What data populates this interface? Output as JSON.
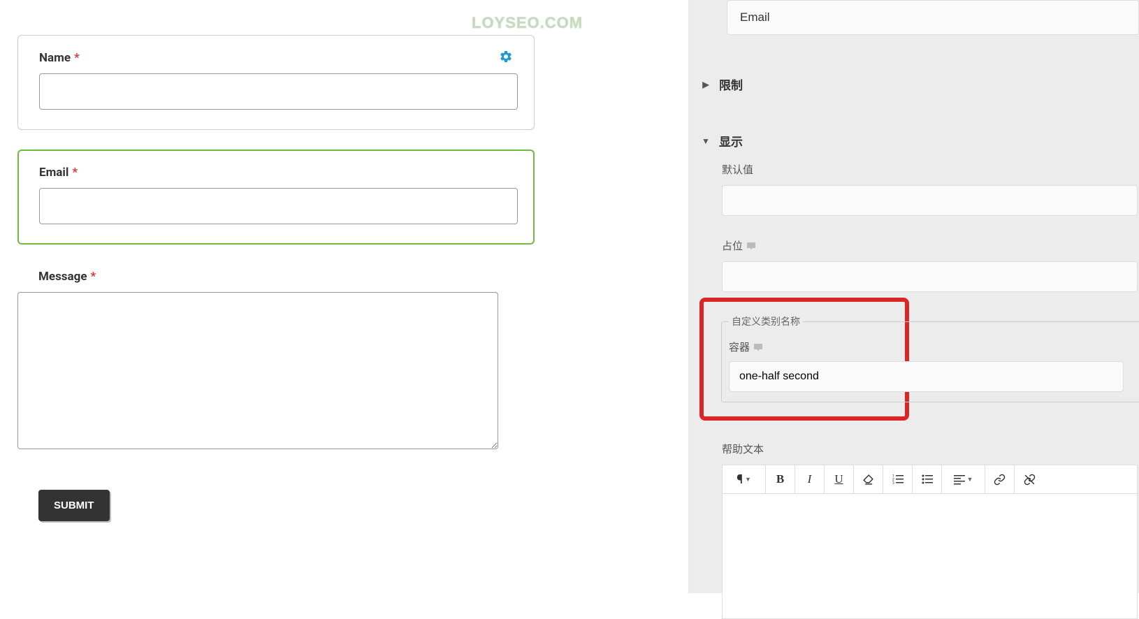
{
  "watermark": "LOYSEO.COM",
  "form": {
    "fields": [
      {
        "label": "Name"
      },
      {
        "label": "Email"
      },
      {
        "label": "Message"
      }
    ],
    "submit_label": "SUBMIT"
  },
  "sidebar": {
    "email_value": "Email",
    "sections": {
      "restriction": "限制",
      "display": "显示"
    },
    "display_panel": {
      "default_value_label": "默认值",
      "default_value": "",
      "placeholder_label": "占位",
      "placeholder_value": "",
      "custom_class_group_label": "自定义类别名称",
      "container_label": "容器",
      "container_value": "one-half second",
      "help_text_label": "帮助文本"
    }
  }
}
